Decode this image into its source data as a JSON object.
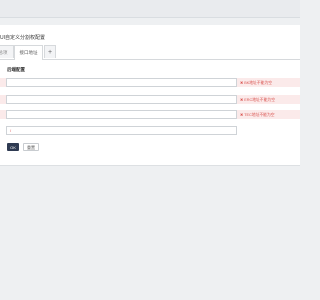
{
  "header": {
    "title": "UI自定义分割权配置"
  },
  "tabs": [
    {
      "label": "总项",
      "active": false
    },
    {
      "label": "接口地址",
      "active": true
    },
    {
      "label": "+",
      "active": false
    }
  ],
  "form": {
    "section_title": "后端配置",
    "fields": [
      {
        "value": "",
        "error": "BK地址不能为空"
      },
      {
        "value": "",
        "error": "ERC地址不能为空"
      },
      {
        "value": "",
        "error": "TEC地址不能为空"
      },
      {
        "value": "/",
        "error": ""
      }
    ],
    "ok_label": "OK",
    "reset_label": "重置"
  },
  "colors": {
    "primary_button": "#2f3b52",
    "error_text": "#d9534f",
    "error_row_bg": "#fbeaea"
  }
}
